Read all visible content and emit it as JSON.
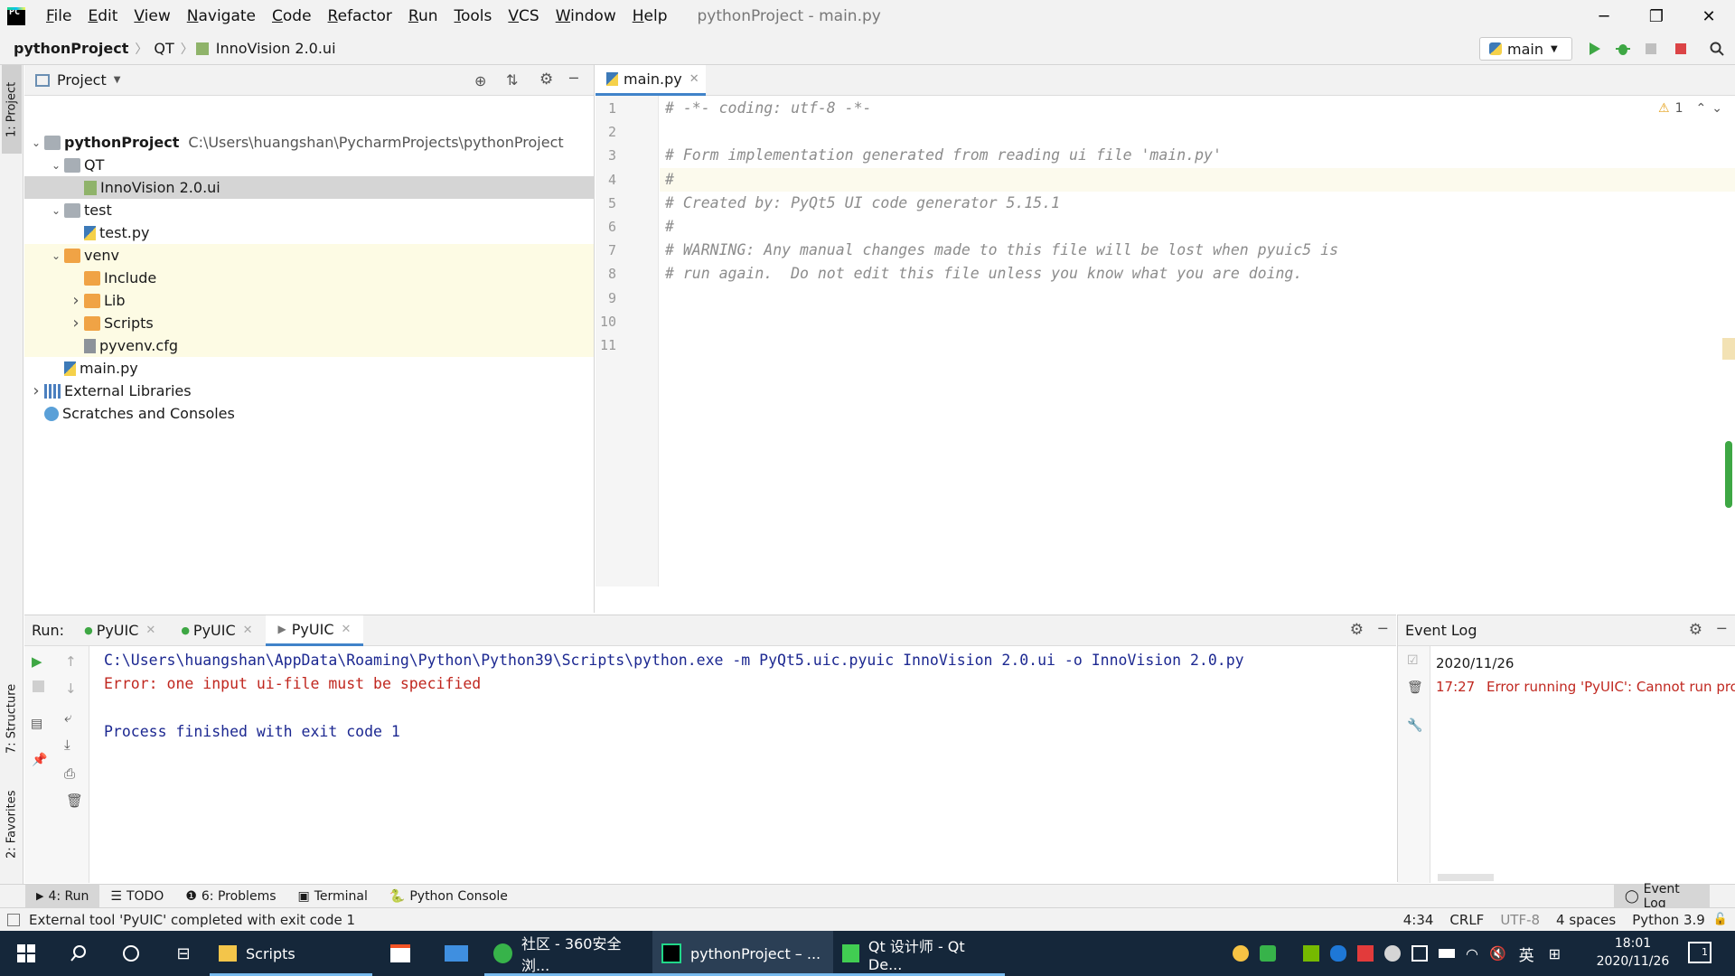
{
  "window": {
    "title": "pythonProject - main.py",
    "menu": [
      "File",
      "Edit",
      "View",
      "Navigate",
      "Code",
      "Refactor",
      "Run",
      "Tools",
      "VCS",
      "Window",
      "Help"
    ]
  },
  "navbar": {
    "breadcrumb": [
      "pythonProject",
      "QT",
      "InnoVision 2.0.ui"
    ],
    "run_config": "main"
  },
  "left_strip": {
    "project_tab": "1: Project",
    "structure_tab": "7: Structure",
    "favorites_tab": "2: Favorites"
  },
  "project_panel": {
    "header": "Project",
    "tree": [
      {
        "label": "pythonProject",
        "path": "C:\\Users\\huangshan\\PycharmProjects\\pythonProject",
        "type": "folder-grey",
        "expanded": true
      },
      {
        "label": "QT",
        "type": "folder-grey",
        "expanded": true
      },
      {
        "label": "InnoVision 2.0.ui",
        "type": "ui-file",
        "selected": true
      },
      {
        "label": "test",
        "type": "folder-grey",
        "expanded": true
      },
      {
        "label": "test.py",
        "type": "py-file"
      },
      {
        "label": "venv",
        "type": "folder-orange",
        "expanded": true
      },
      {
        "label": "Include",
        "type": "folder-orange"
      },
      {
        "label": "Lib",
        "type": "folder-orange",
        "expanded": false
      },
      {
        "label": "Scripts",
        "type": "folder-orange",
        "expanded": false
      },
      {
        "label": "pyvenv.cfg",
        "type": "cfg-file"
      },
      {
        "label": "main.py",
        "type": "py-file"
      },
      {
        "label": "External Libraries",
        "type": "library",
        "expanded": false
      },
      {
        "label": "Scratches and Consoles",
        "type": "scratch"
      }
    ]
  },
  "editor": {
    "tab": "main.py",
    "warnings": "1",
    "lines": [
      "# -*- coding: utf-8 -*-",
      "",
      "# Form implementation generated from reading ui file 'main.py'",
      "#",
      "# Created by: PyQt5 UI code generator 5.15.1",
      "#",
      "# WARNING: Any manual changes made to this file will be lost when pyuic5 is",
      "# run again.  Do not edit this file unless you know what you are doing.",
      "",
      "",
      ""
    ],
    "line_numbers": [
      "1",
      "2",
      "3",
      "4",
      "5",
      "6",
      "7",
      "8",
      "9",
      "10",
      "11"
    ]
  },
  "run_panel": {
    "label": "Run:",
    "tabs": [
      "PyUIC",
      "PyUIC",
      "PyUIC"
    ],
    "console": [
      {
        "text": "C:\\Users\\huangshan\\AppData\\Roaming\\Python\\Python39\\Scripts\\python.exe -m PyQt5.uic.pyuic InnoVision 2.0.ui -o InnoVision 2.0.py",
        "color": "#1c2891"
      },
      {
        "text": "Error: one input ui-file must be specified",
        "color": "#c0271f"
      },
      {
        "text": "",
        "color": "#1c2891"
      },
      {
        "text": "Process finished with exit code 1",
        "color": "#1c2891"
      }
    ]
  },
  "event_log": {
    "title": "Event Log",
    "date": "2020/11/26",
    "time": "17:27",
    "message": "Error running 'PyUIC': Cannot run progr"
  },
  "tool_strip": {
    "run": "4: Run",
    "todo": "TODO",
    "problems": "6: Problems",
    "terminal": "Terminal",
    "python_console": "Python Console",
    "event_log": "Event Log"
  },
  "status_bar": {
    "message": "External tool 'PyUIC' completed with exit code 1",
    "position": "4:34",
    "line_sep": "CRLF",
    "encoding": "UTF-8",
    "indent": "4 spaces",
    "interpreter": "Python 3.9"
  },
  "taskbar": {
    "apps": [
      {
        "label": "Scripts",
        "icon": "folder-icon"
      },
      {
        "label": "社区 - 360安全浏...",
        "icon": "browser-360-icon"
      },
      {
        "label": "pythonProject – ...",
        "icon": "pycharm-icon",
        "active": true
      },
      {
        "label": "Qt 设计师 - Qt De...",
        "icon": "qt-designer-icon"
      }
    ],
    "ime": "英",
    "time": "18:01",
    "date": "2020/11/26",
    "notifications": "1"
  },
  "colors": {
    "accent": "#4083c9",
    "venv_highlight": "#fdfbe4",
    "selected_row": "#d5d5d5",
    "console_blue": "#1c2891",
    "console_red": "#c0271f",
    "taskbar": "#15273a"
  }
}
